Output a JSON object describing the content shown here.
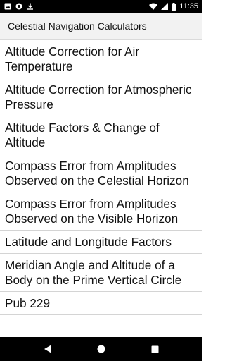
{
  "status_bar": {
    "time": "11:35",
    "icons": [
      "image-icon",
      "circle-app-icon",
      "download-icon",
      "wifi-icon",
      "signal-icon",
      "battery-icon"
    ]
  },
  "app_bar": {
    "title": "Celestial Navigation Calculators"
  },
  "list": {
    "items": [
      {
        "label": "Altitude Correction for Air Temperature"
      },
      {
        "label": "Altitude Correction for Atmospheric Pressure"
      },
      {
        "label": "Altitude Factors & Change of Altitude"
      },
      {
        "label": "Compass Error from Amplitudes Observed on the Celestial Horizon"
      },
      {
        "label": "Compass Error from Amplitudes Observed on the Visible Horizon"
      },
      {
        "label": "Latitude and Longitude Factors"
      },
      {
        "label": "Meridian Angle and Altitude of a Body on the Prime Vertical Circle"
      },
      {
        "label": "Pub 229"
      }
    ]
  },
  "nav_bar": {
    "icons": [
      "back-icon",
      "home-icon",
      "recents-icon"
    ]
  },
  "colors": {
    "status_bar": "#000000",
    "app_bar": "#f2f2f2",
    "background": "#ffffff",
    "divider": "#d4d4d4",
    "text": "#111111"
  }
}
